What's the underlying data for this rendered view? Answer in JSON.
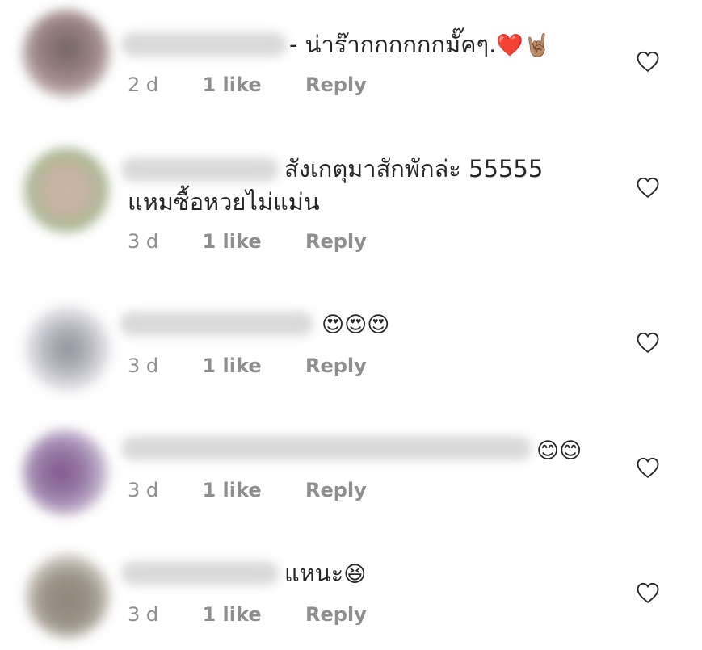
{
  "comments": [
    {
      "text_lines": [
        "- น่าร๊ากกกกกกมั๊คๆ."
      ],
      "emoji": "❤️🤘🏽",
      "age": "2 d",
      "likes": "1 like",
      "reply": "Reply",
      "avatar_color": "#8a7070"
    },
    {
      "text_lines": [
        "สังเกตุมาสักพักล่ะ 55555",
        "แหมซื้อหวยไม่แม่น"
      ],
      "emoji": "",
      "age": "3 d",
      "likes": "1 like",
      "reply": "Reply",
      "avatar_color": "#b8a890"
    },
    {
      "text_lines": [
        ""
      ],
      "emoji": "😍😍😍",
      "age": "3 d",
      "likes": "1 like",
      "reply": "Reply",
      "avatar_color": "#a8aab2"
    },
    {
      "text_lines": [
        ""
      ],
      "emoji": "😊😊",
      "age": "3 d",
      "likes": "1 like",
      "reply": "Reply",
      "avatar_color": "#8a6a9a"
    },
    {
      "text_lines": [
        "แหนะ"
      ],
      "emoji": "😆",
      "age": "3 d",
      "likes": "1 like",
      "reply": "Reply",
      "avatar_color": "#8a8272"
    }
  ],
  "icons": {
    "like": "heart-outline-icon"
  }
}
